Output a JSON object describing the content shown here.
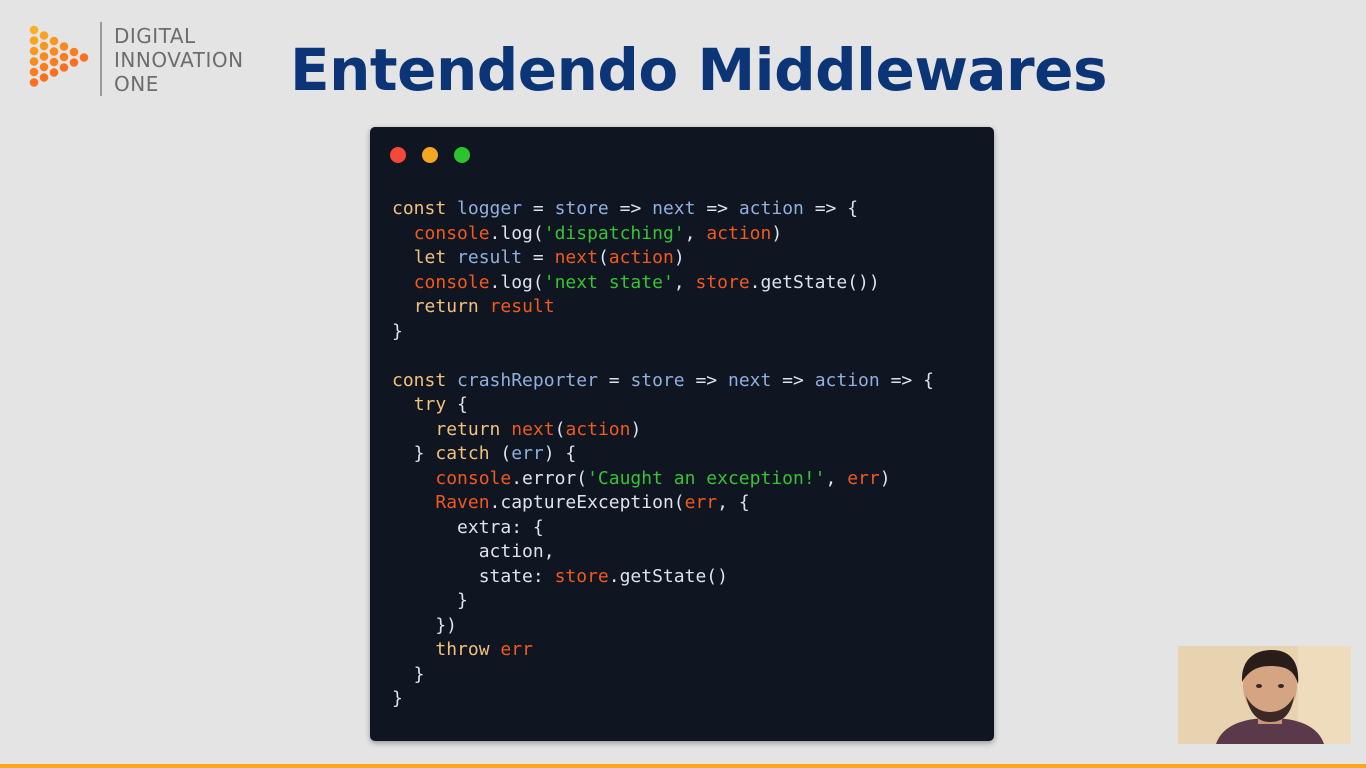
{
  "logo": {
    "line1": "DIGITAL",
    "line2": "INNOVATION",
    "line3": "ONE"
  },
  "title": "Entendendo Middlewares",
  "window_dots": [
    {
      "name": "close",
      "color": "#f6483a"
    },
    {
      "name": "minimize",
      "color": "#f5a623"
    },
    {
      "name": "maximize",
      "color": "#2cc42c"
    }
  ],
  "colors": {
    "title": "#0b3577",
    "keyword": "#f0c27a",
    "identifier": "#8fb1dd",
    "object": "#f25a1c",
    "string": "#35c435",
    "code_bg": "#0f1521"
  },
  "code_lines": [
    [
      [
        "kw",
        "const"
      ],
      [
        "op",
        " "
      ],
      [
        "var",
        "logger"
      ],
      [
        "op",
        " = "
      ],
      [
        "var",
        "store"
      ],
      [
        "op",
        " => "
      ],
      [
        "var",
        "next"
      ],
      [
        "op",
        " => "
      ],
      [
        "var",
        "action"
      ],
      [
        "op",
        " => {"
      ]
    ],
    [
      [
        "op",
        "  "
      ],
      [
        "obj",
        "console"
      ],
      [
        "op",
        ".log("
      ],
      [
        "str",
        "'dispatching'"
      ],
      [
        "op",
        ", "
      ],
      [
        "obj",
        "action"
      ],
      [
        "op",
        ")"
      ]
    ],
    [
      [
        "op",
        "  "
      ],
      [
        "kw",
        "let"
      ],
      [
        "op",
        " "
      ],
      [
        "var",
        "result"
      ],
      [
        "op",
        " = "
      ],
      [
        "obj",
        "next"
      ],
      [
        "op",
        "("
      ],
      [
        "obj",
        "action"
      ],
      [
        "op",
        ")"
      ]
    ],
    [
      [
        "op",
        "  "
      ],
      [
        "obj",
        "console"
      ],
      [
        "op",
        ".log("
      ],
      [
        "str",
        "'next state'"
      ],
      [
        "op",
        ", "
      ],
      [
        "obj",
        "store"
      ],
      [
        "op",
        ".getState())"
      ]
    ],
    [
      [
        "op",
        "  "
      ],
      [
        "kw",
        "return"
      ],
      [
        "op",
        " "
      ],
      [
        "obj",
        "result"
      ]
    ],
    [
      [
        "op",
        "}"
      ]
    ],
    [],
    [
      [
        "kw",
        "const"
      ],
      [
        "op",
        " "
      ],
      [
        "var",
        "crashReporter"
      ],
      [
        "op",
        " = "
      ],
      [
        "var",
        "store"
      ],
      [
        "op",
        " => "
      ],
      [
        "var",
        "next"
      ],
      [
        "op",
        " => "
      ],
      [
        "var",
        "action"
      ],
      [
        "op",
        " => {"
      ]
    ],
    [
      [
        "op",
        "  "
      ],
      [
        "kw",
        "try"
      ],
      [
        "op",
        " {"
      ]
    ],
    [
      [
        "op",
        "    "
      ],
      [
        "kw",
        "return"
      ],
      [
        "op",
        " "
      ],
      [
        "obj",
        "next"
      ],
      [
        "op",
        "("
      ],
      [
        "obj",
        "action"
      ],
      [
        "op",
        ")"
      ]
    ],
    [
      [
        "op",
        "  } "
      ],
      [
        "kw",
        "catch"
      ],
      [
        "op",
        " ("
      ],
      [
        "var",
        "err"
      ],
      [
        "op",
        ") {"
      ]
    ],
    [
      [
        "op",
        "    "
      ],
      [
        "obj",
        "console"
      ],
      [
        "op",
        ".error("
      ],
      [
        "str",
        "'Caught an exception!'"
      ],
      [
        "op",
        ", "
      ],
      [
        "obj",
        "err"
      ],
      [
        "op",
        ")"
      ]
    ],
    [
      [
        "op",
        "    "
      ],
      [
        "obj",
        "Raven"
      ],
      [
        "op",
        ".captureException("
      ],
      [
        "obj",
        "err"
      ],
      [
        "op",
        ", {"
      ]
    ],
    [
      [
        "op",
        "      extra: {"
      ]
    ],
    [
      [
        "op",
        "        action,"
      ]
    ],
    [
      [
        "op",
        "        state: "
      ],
      [
        "obj",
        "store"
      ],
      [
        "op",
        ".getState()"
      ]
    ],
    [
      [
        "op",
        "      }"
      ]
    ],
    [
      [
        "op",
        "    })"
      ]
    ],
    [
      [
        "op",
        "    "
      ],
      [
        "kw",
        "throw"
      ],
      [
        "op",
        " "
      ],
      [
        "obj",
        "err"
      ]
    ],
    [
      [
        "op",
        "  }"
      ]
    ],
    [
      [
        "op",
        "}"
      ]
    ]
  ]
}
